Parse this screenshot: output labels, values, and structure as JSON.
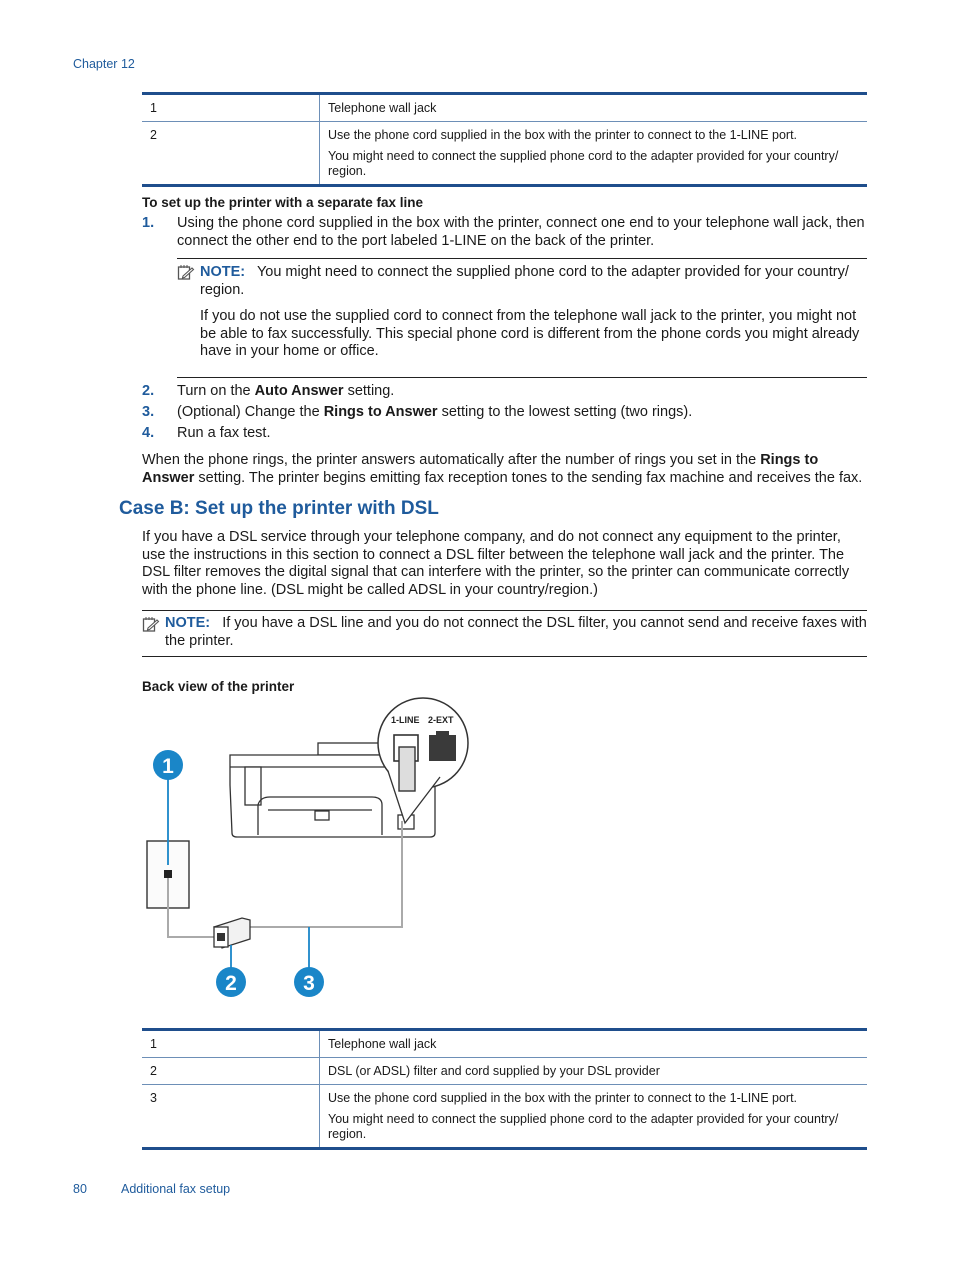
{
  "header": {
    "running_head": "Chapter 12"
  },
  "table1": {
    "rows": [
      {
        "num": "1",
        "desc": [
          "Telephone wall jack"
        ]
      },
      {
        "num": "2",
        "desc": [
          "Use the phone cord supplied in the box with the printer to connect to the 1-LINE port.",
          "You might need to connect the supplied phone cord to the adapter provided for your country/ region."
        ]
      }
    ]
  },
  "procedure": {
    "title": "To set up the printer with a separate fax line",
    "steps": [
      {
        "num": "1.",
        "text": "Using the phone cord supplied in the box with the printer, connect one end to your telephone wall jack, then connect the other end to the port labeled 1-LINE on the back of the printer."
      },
      {
        "num": "2.",
        "pre": "Turn on the ",
        "bold": "Auto Answer",
        "post": " setting."
      },
      {
        "num": "3.",
        "pre": "(Optional) Change the ",
        "bold": "Rings to Answer",
        "post": " setting to the lowest setting (two rings)."
      },
      {
        "num": "4.",
        "text": "Run a fax test."
      }
    ],
    "note": {
      "icon": "note-icon",
      "label": "NOTE:",
      "text": "You might need to connect the supplied phone cord to the adapter provided for your country/ region.",
      "text2": "If you do not use the supplied cord to connect from the telephone wall jack to the printer, you might not be able to fax successfully. This special phone cord is different from the phone cords you might already have in your home or office."
    },
    "result": {
      "pre": "When the phone rings, the printer answers automatically after the number of rings you set in the ",
      "bold": "Rings to Answer",
      "post": " setting. The printer begins emitting fax reception tones to the sending fax machine and receives the fax."
    }
  },
  "case_b": {
    "heading": "Case B: Set up the printer with DSL",
    "intro": "If you have a DSL service through your telephone company, and do not connect any equipment to the printer, use the instructions in this section to connect a DSL filter between the telephone wall jack and the printer. The DSL filter removes the digital signal that can interfere with the printer, so the printer can communicate correctly with the phone line. (DSL might be called ADSL in your country/region.)",
    "note": {
      "icon": "note-icon",
      "label": "NOTE:",
      "text": "If you have a DSL line and you do not connect the DSL filter, you cannot send and receive faxes with the printer."
    },
    "figure": {
      "title": "Back view of the printer",
      "port_labels": [
        "1-LINE",
        "2-EXT"
      ],
      "callouts": [
        "1",
        "2",
        "3"
      ]
    }
  },
  "table2": {
    "rows": [
      {
        "num": "1",
        "desc": [
          "Telephone wall jack"
        ]
      },
      {
        "num": "2",
        "desc": [
          "DSL (or ADSL) filter and cord supplied by your DSL provider"
        ]
      },
      {
        "num": "3",
        "desc": [
          "Use the phone cord supplied in the box with the printer to connect to the 1-LINE port.",
          "You might need to connect the supplied phone cord to the adapter provided for your country/ region."
        ]
      }
    ]
  },
  "footer": {
    "page_number": "80",
    "section": "Additional fax setup"
  },
  "colors": {
    "accent": "#1f5b9c",
    "rule": "#1f4e8c",
    "callout": "#1a86c8"
  }
}
